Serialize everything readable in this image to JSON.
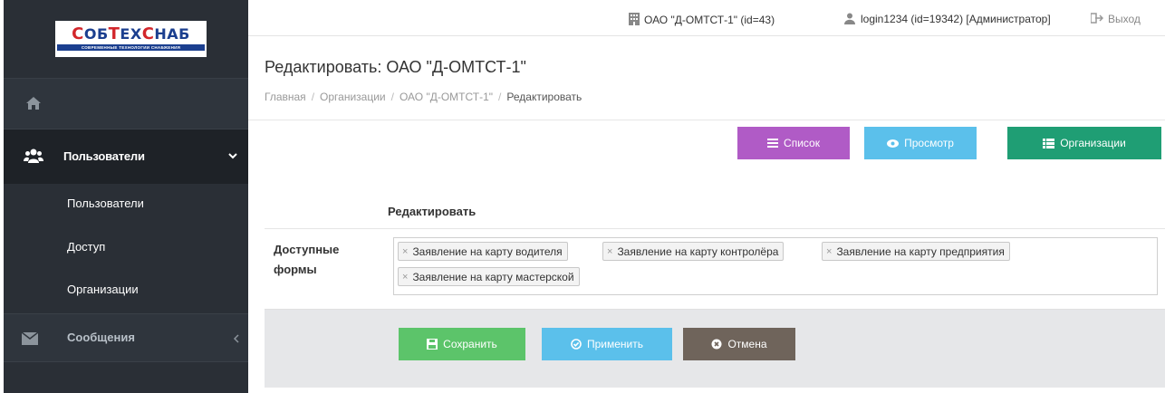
{
  "brand": {
    "logo_title_parts": [
      "С",
      "ОБ",
      "Т",
      "ЕХ",
      "С",
      "НАБ"
    ],
    "logo_subtitle": "СОВРЕМЕННЫЕ ТЕХНОЛОГИИ СНАБЖЕНИЯ",
    "colors": {
      "blue": "#1b3f8f",
      "red": "#d2262b"
    }
  },
  "sidebar": {
    "home_icon": "home-icon",
    "users_section": {
      "label": "Пользователи",
      "icon": "users-icon",
      "expanded": true
    },
    "sub_items": [
      {
        "label": "Пользователи"
      },
      {
        "label": "Доступ"
      },
      {
        "label": "Организации"
      }
    ],
    "messages_section": {
      "label": "Сообщения",
      "icon": "envelope-icon",
      "expanded": false
    }
  },
  "topbar": {
    "organization": "ОАО \"Д-ОМТСТ-1\" (id=43)",
    "user": "login1234 (id=19342) [Администратор]",
    "logout": "Выход"
  },
  "header": {
    "title": "Редактировать: ОАО \"Д-ОМТСТ-1\"",
    "breadcrumb": [
      "Главная",
      "Организации",
      "ОАО \"Д-ОМТСТ-1\"",
      "Редактировать"
    ]
  },
  "toolbar": {
    "list_label": "Список",
    "view_label": "Просмотр",
    "orgs_label": "Организации",
    "colors": {
      "list": "#b05bc6",
      "view": "#5bc0eb",
      "orgs": "#1f9e74"
    }
  },
  "form": {
    "heading": "Редактировать",
    "field_label": "Доступные формы",
    "tags": [
      "Заявление на карту водителя",
      "Заявление на карту контролёра",
      "Заявление на карту предприятия",
      "Заявление на карту мастерской"
    ],
    "save_label": "Сохранить",
    "apply_label": "Применить",
    "cancel_label": "Отмена",
    "colors": {
      "save": "#5cc46a",
      "apply": "#5bc0eb",
      "cancel": "#6f645b"
    }
  }
}
